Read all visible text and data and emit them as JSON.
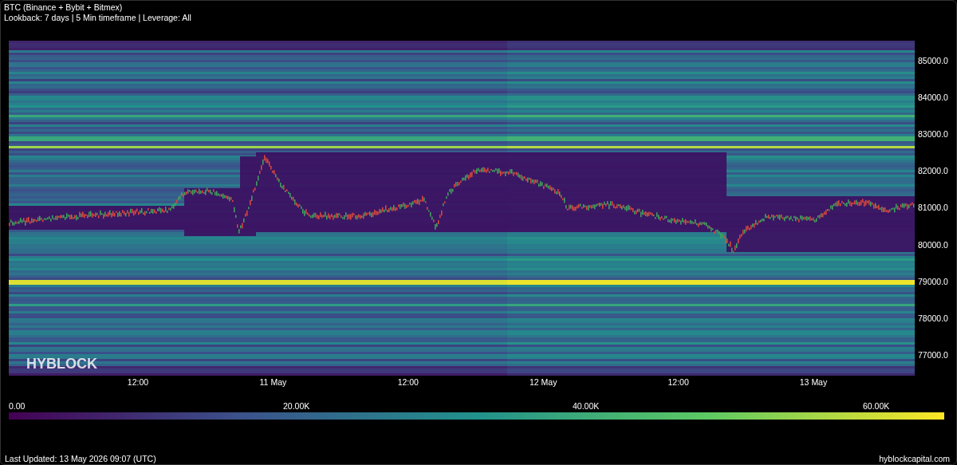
{
  "header": {
    "title": "BTC (Binance + Bybit + Bitmex)",
    "subtitle": "Lookback: 7 days | 5 Min timeframe | Leverage: All"
  },
  "heatmap": {
    "logo": "HYBLOCK",
    "y_ticks": [
      "85000.0",
      "84000.0",
      "83000.0",
      "82000.0",
      "81000.0",
      "80000.0",
      "79000.0",
      "78000.0",
      "77000.0"
    ],
    "x_ticks": [
      "12:00",
      "11 May",
      "12:00",
      "12 May",
      "12:00",
      "13 May"
    ]
  },
  "color_scale": {
    "labels": [
      "0.00",
      "20.00K",
      "40.00K",
      "60.00K"
    ]
  },
  "footer": {
    "updated": "Last Updated: 13 May 2026 09:07 (UTC)",
    "site": "hyblockcapital.com"
  }
}
